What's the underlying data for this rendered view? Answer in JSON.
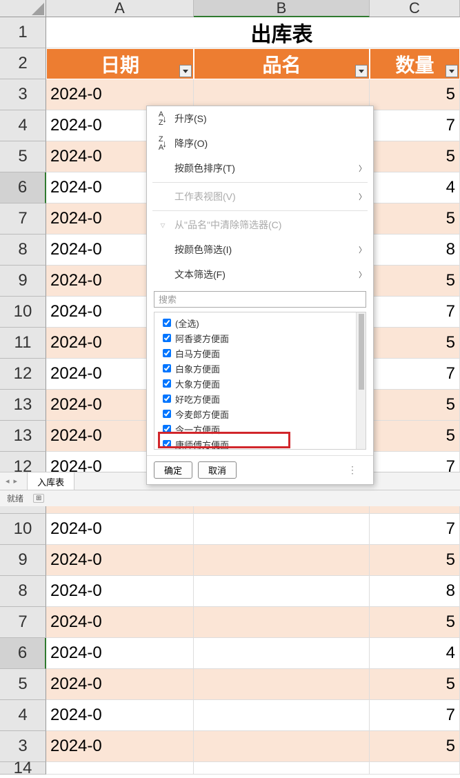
{
  "columns": [
    "A",
    "B",
    "C"
  ],
  "title": "出库表",
  "headers": {
    "date": "日期",
    "name": "品名",
    "qty": "数量"
  },
  "rows": [
    {
      "n": "3",
      "date": "2024-0",
      "qty": "5",
      "alt": true
    },
    {
      "n": "4",
      "date": "2024-0",
      "qty": "7",
      "alt": false
    },
    {
      "n": "5",
      "date": "2024-0",
      "qty": "5",
      "alt": true
    },
    {
      "n": "6",
      "date": "2024-0",
      "qty": "4",
      "alt": false,
      "selected": true
    },
    {
      "n": "7",
      "date": "2024-0",
      "qty": "5",
      "alt": true
    },
    {
      "n": "8",
      "date": "2024-0",
      "qty": "8",
      "alt": false
    },
    {
      "n": "9",
      "date": "2024-0",
      "qty": "5",
      "alt": true
    },
    {
      "n": "10",
      "date": "2024-0",
      "qty": "7",
      "alt": false
    },
    {
      "n": "11",
      "date": "2024-0",
      "qty": "5",
      "alt": true
    },
    {
      "n": "12",
      "date": "2024-0",
      "qty": "7",
      "alt": false
    },
    {
      "n": "13",
      "date": "2024-0",
      "qty": "5",
      "alt": true
    }
  ],
  "partial_row": "14",
  "filter_menu": {
    "sort_asc": "升序(S)",
    "sort_desc": "降序(O)",
    "sort_by_color": "按颜色排序(T)",
    "sheet_view": "工作表视图(V)",
    "clear_filter": "从\"品名\"中清除筛选器(C)",
    "filter_by_color": "按颜色筛选(I)",
    "text_filter": "文本筛选(F)",
    "search_placeholder": "搜索",
    "items": [
      "(全选)",
      "阿香婆方便面",
      "白马方便面",
      "白象方便面",
      "大象方便面",
      "好吃方便面",
      "今麦郎方便面",
      "今一方便面",
      "康师傅方便面"
    ],
    "ok": "确定",
    "cancel": "取消"
  },
  "sheet_tab": "入库表",
  "status": {
    "ready": "就绪"
  }
}
